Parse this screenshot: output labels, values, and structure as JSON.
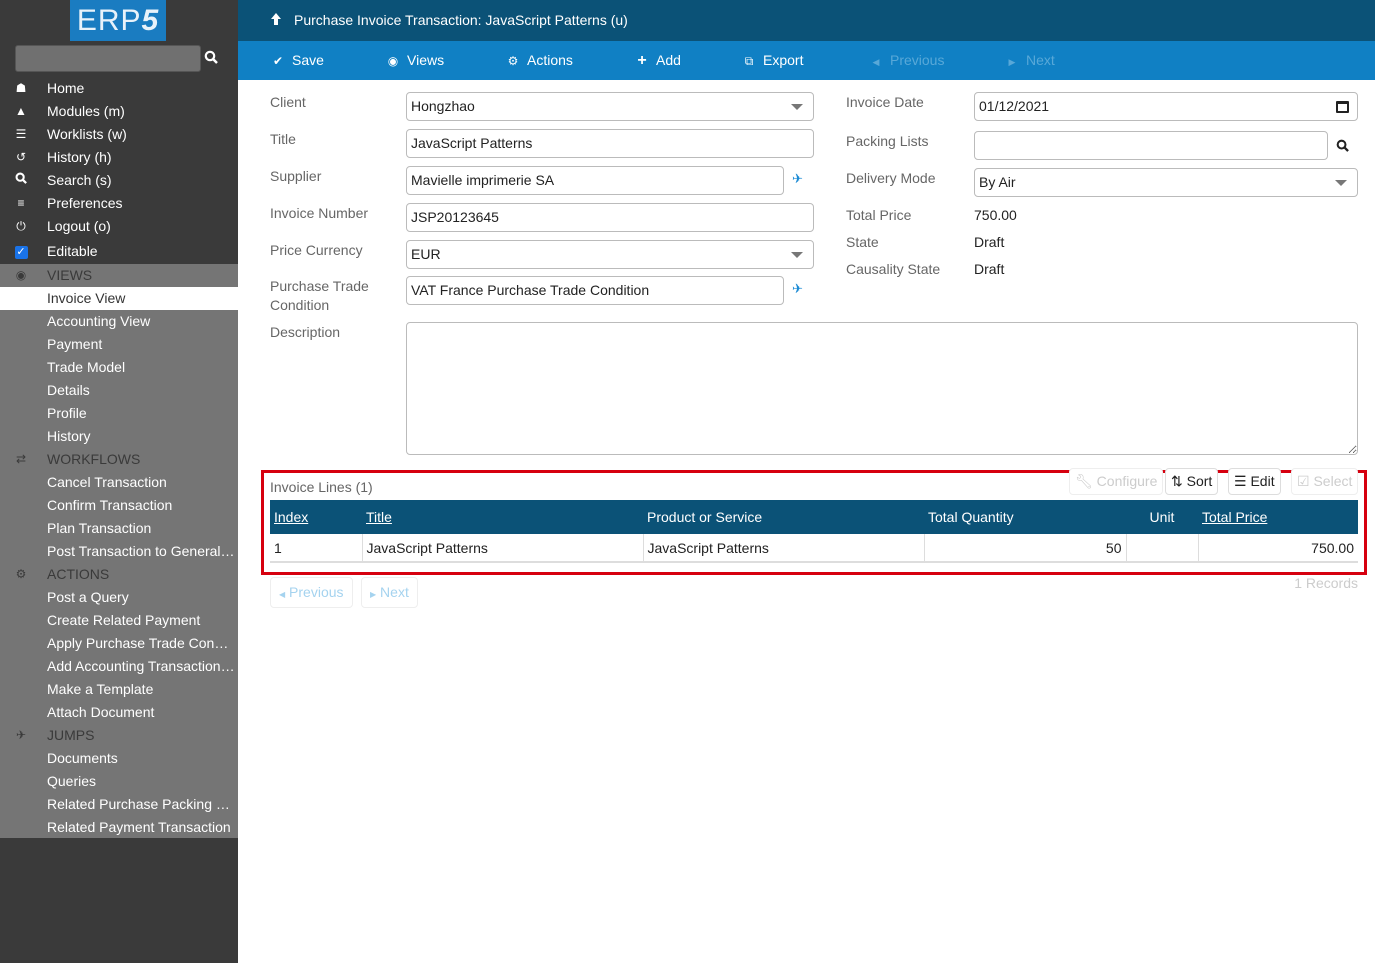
{
  "app": {
    "logo_text": "ERP",
    "logo_suffix": "5"
  },
  "header": {
    "title": "Purchase Invoice Transaction: JavaScript Patterns (u)"
  },
  "toolbar": {
    "save": "Save",
    "views": "Views",
    "actions": "Actions",
    "add": "Add",
    "export": "Export",
    "previous": "Previous",
    "next": "Next"
  },
  "sidebar": {
    "search_placeholder": "",
    "main": [
      {
        "label": "Home",
        "icon": "home-icon"
      },
      {
        "label": "Modules (m)",
        "icon": "puzzle-icon"
      },
      {
        "label": "Worklists (w)",
        "icon": "tasks-icon"
      },
      {
        "label": "History (h)",
        "icon": "history-icon"
      },
      {
        "label": "Search (s)",
        "icon": "search-icon"
      },
      {
        "label": "Preferences",
        "icon": "sliders-icon"
      },
      {
        "label": "Logout (o)",
        "icon": "power-icon"
      },
      {
        "label": "Editable",
        "icon": "checkbox-icon",
        "checked": true
      }
    ],
    "views_header": "VIEWS",
    "views": [
      "Invoice View",
      "Accounting View",
      "Payment",
      "Trade Model",
      "Details",
      "Profile",
      "History"
    ],
    "active_view": "Invoice View",
    "workflows_header": "WORKFLOWS",
    "workflows": [
      "Cancel Transaction",
      "Confirm Transaction",
      "Plan Transaction",
      "Post Transaction to General L..."
    ],
    "actions_header": "ACTIONS",
    "actions": [
      "Post a Query",
      "Create Related Payment",
      "Apply Purchase Trade Conditi...",
      "Add Accounting Transaction L...",
      "Make a Template",
      "Attach Document"
    ],
    "jumps_header": "JUMPS",
    "jumps": [
      "Documents",
      "Queries",
      "Related Purchase Packing List",
      "Related Payment Transaction"
    ]
  },
  "form": {
    "client": {
      "label": "Client",
      "value": "Hongzhao"
    },
    "title": {
      "label": "Title",
      "value": "JavaScript Patterns"
    },
    "supplier": {
      "label": "Supplier",
      "value": "Mavielle imprimerie SA"
    },
    "invoice_number": {
      "label": "Invoice Number",
      "value": "JSP20123645"
    },
    "price_currency": {
      "label": "Price Currency",
      "value": "EUR"
    },
    "trade_condition": {
      "label": "Purchase Trade Condition",
      "value": "VAT France Purchase Trade Condition"
    },
    "description": {
      "label": "Description",
      "value": ""
    },
    "invoice_date": {
      "label": "Invoice Date",
      "value": "01/12/2021"
    },
    "packing_lists": {
      "label": "Packing Lists",
      "value": ""
    },
    "delivery_mode": {
      "label": "Delivery Mode",
      "value": "By Air"
    },
    "total_price": {
      "label": "Total Price",
      "value": "750.00"
    },
    "state": {
      "label": "State",
      "value": "Draft"
    },
    "causality_state": {
      "label": "Causality State",
      "value": "Draft"
    }
  },
  "lines": {
    "title": "Invoice Lines (1)",
    "buttons": {
      "configure": "Configure",
      "sort": "Sort",
      "edit": "Edit",
      "select": "Select"
    },
    "columns": [
      "Index",
      "Title",
      "Product or Service",
      "Total Quantity",
      "Unit",
      "Total Price"
    ],
    "rows": [
      [
        "1",
        "JavaScript Patterns",
        "JavaScript Patterns",
        "50",
        "",
        "750.00"
      ]
    ],
    "records": "1 Records",
    "previous": "Previous",
    "next": "Next"
  },
  "colors": {
    "header": "#0b5277",
    "toolbar": "#1080c4",
    "highlight": "#d6000f"
  }
}
